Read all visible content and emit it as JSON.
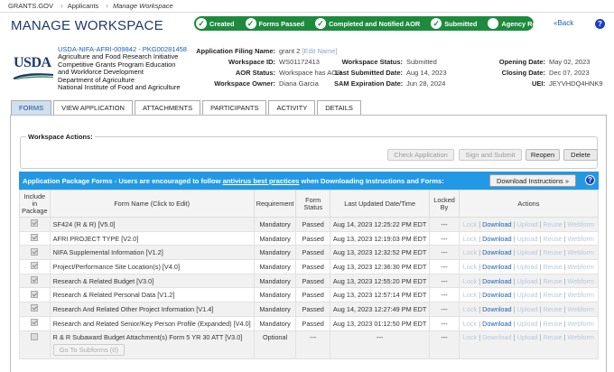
{
  "breadcrumb": [
    "GRANTS.GOV",
    "Applicants",
    "Manage Workspace"
  ],
  "page_title": "MANAGE WORKSPACE",
  "progress_steps": [
    {
      "label": "Created",
      "done": true
    },
    {
      "label": "Forms Passed",
      "done": true
    },
    {
      "label": "Completed and Notified AOR",
      "done": true
    },
    {
      "label": "Submitted",
      "done": true
    },
    {
      "label": "Agency Received",
      "done": false
    }
  ],
  "back_label": "«Back",
  "help_label": "?",
  "logo_text": "USDA",
  "agency": {
    "opp_number": "USDA-NIFA-AFRI-009842 - PKG00281458",
    "lines": [
      "Agriculture and Food Research Initiative",
      "Competitive Grants Program Education",
      "and Workforce Development",
      "Department of Agriculture",
      "National Institute of Food and Agriculture"
    ]
  },
  "workspace": {
    "filing_name_label": "Application Filing Name:",
    "filing_name": "grant 2",
    "edit_name": "[Edit Name]",
    "id_label": "Workspace ID:",
    "id": "WS01172413",
    "aor_label": "AOR Status:",
    "aor": "Workspace has AOR",
    "owner_label": "Workspace Owner:",
    "owner": "Diana Garcia",
    "status_label": "Workspace Status:",
    "status": "Submitted",
    "last_submitted_label": "Last Submitted Date:",
    "last_submitted": "Aug 14, 2023",
    "sam_label": "SAM Expiration Date:",
    "sam": "Jun 28, 2024",
    "opening_label": "Opening Date:",
    "opening": "May 02, 2023",
    "closing_label": "Closing Date:",
    "closing": "Dec 07, 2023",
    "uei_label": "UEI:",
    "uei": "JEYVHDQ4HNK9"
  },
  "tabs": [
    "FORMS",
    "VIEW APPLICATION",
    "ATTACHMENTS",
    "PARTICIPANTS",
    "ACTIVITY",
    "DETAILS"
  ],
  "workspace_actions": {
    "title": "Workspace Actions:",
    "buttons": [
      "Check Application",
      "Sign and Submit",
      "Reopen",
      "Delete"
    ]
  },
  "package": {
    "header_pre": "Application Package Forms - Users are encouraged to follow ",
    "header_link": "antivirus best practices",
    "header_post": " when Downloading Instructions and Forms:",
    "download_label": "Download Instructions »"
  },
  "table": {
    "headers": [
      "Include in Package",
      "Form Name (Click to Edit)",
      "Requirement",
      "Form Status",
      "Last Updated Date/Time",
      "Locked By",
      "Actions"
    ],
    "rows": [
      {
        "name": "SF424 (R & R) [V5.0]",
        "req": "Mandatory",
        "status": "Passed",
        "updated": "Aug 14, 2023 12:25:22 PM EDT",
        "locked": "---"
      },
      {
        "name": "AFRI PROJECT TYPE [V2.0]",
        "req": "Mandatory",
        "status": "Passed",
        "updated": "Aug 13, 2023 12:19:03 PM EDT",
        "locked": "---"
      },
      {
        "name": "NIFA Supplemental Information [V1.2]",
        "req": "Mandatory",
        "status": "Passed",
        "updated": "Aug 13, 2023 12:32:52 PM EDT",
        "locked": "---"
      },
      {
        "name": "Project/Performance Site Location(s) [V4.0]",
        "req": "Mandatory",
        "status": "Passed",
        "updated": "Aug 13, 2023 12:36:30 PM EDT",
        "locked": "---"
      },
      {
        "name": "Research & Related Budget [V3.0]",
        "req": "Mandatory",
        "status": "Passed",
        "updated": "Aug 13, 2023 12:55:20 PM EDT",
        "locked": "---"
      },
      {
        "name": "Research & Related Personal Data [V1.2]",
        "req": "Mandatory",
        "status": "Passed",
        "updated": "Aug 13, 2023 12:57:14 PM EDT",
        "locked": "---"
      },
      {
        "name": "Research And Related Other Project Information [V1.4]",
        "req": "Mandatory",
        "status": "Passed",
        "updated": "Aug 14, 2023 12:27:49 PM EDT",
        "locked": "---"
      },
      {
        "name": "Research and Related Senior/Key Person Profile (Expanded) [V4.0]",
        "req": "Mandatory",
        "status": "Passed",
        "updated": "Aug 13, 2023 01:12:50 PM EDT",
        "locked": "---"
      }
    ],
    "optional_row": {
      "name": "R & R Subaward Budget Attachment(s) Form 5 YR 30 ATT [V3.0]",
      "req": "Optional",
      "status": "---",
      "updated": "---",
      "locked": "---",
      "subforms_label": "Go To Subforms (0)"
    },
    "actions": [
      "Lock",
      "Download",
      "Upload",
      "Reuse",
      "Webform"
    ]
  }
}
